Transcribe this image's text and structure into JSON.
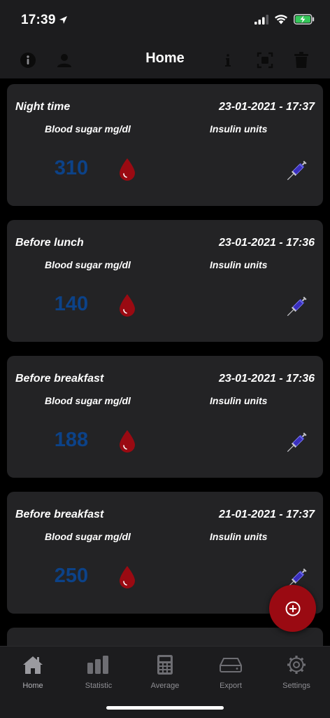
{
  "status": {
    "time": "17:39"
  },
  "nav": {
    "title": "Home"
  },
  "entries": [
    {
      "period": "Night time",
      "datetime": "23-01-2021 - 17:37",
      "bs_label": "Blood sugar mg/dl",
      "insulin_label": "Insulin units",
      "value": "310"
    },
    {
      "period": "Before lunch",
      "datetime": "23-01-2021 - 17:36",
      "bs_label": "Blood sugar mg/dl",
      "insulin_label": "Insulin units",
      "value": "140"
    },
    {
      "period": "Before breakfast",
      "datetime": "23-01-2021 - 17:36",
      "bs_label": "Blood sugar mg/dl",
      "insulin_label": "Insulin units",
      "value": "188"
    },
    {
      "period": "Before breakfast",
      "datetime": "21-01-2021 - 17:37",
      "bs_label": "Blood sugar mg/dl",
      "insulin_label": "Insulin units",
      "value": "250"
    }
  ],
  "tabs": [
    {
      "label": "Home",
      "icon": "house-icon"
    },
    {
      "label": "Statistic",
      "icon": "bar-chart-icon"
    },
    {
      "label": "Average",
      "icon": "calculator-icon"
    },
    {
      "label": "Export",
      "icon": "hard-drive-icon"
    },
    {
      "label": "Settings",
      "icon": "gear-icon"
    }
  ],
  "colors": {
    "value": "#0c4288",
    "drop": "#9a0a12",
    "fab": "#9a0a12",
    "background": "#000000",
    "card": "#232325"
  }
}
